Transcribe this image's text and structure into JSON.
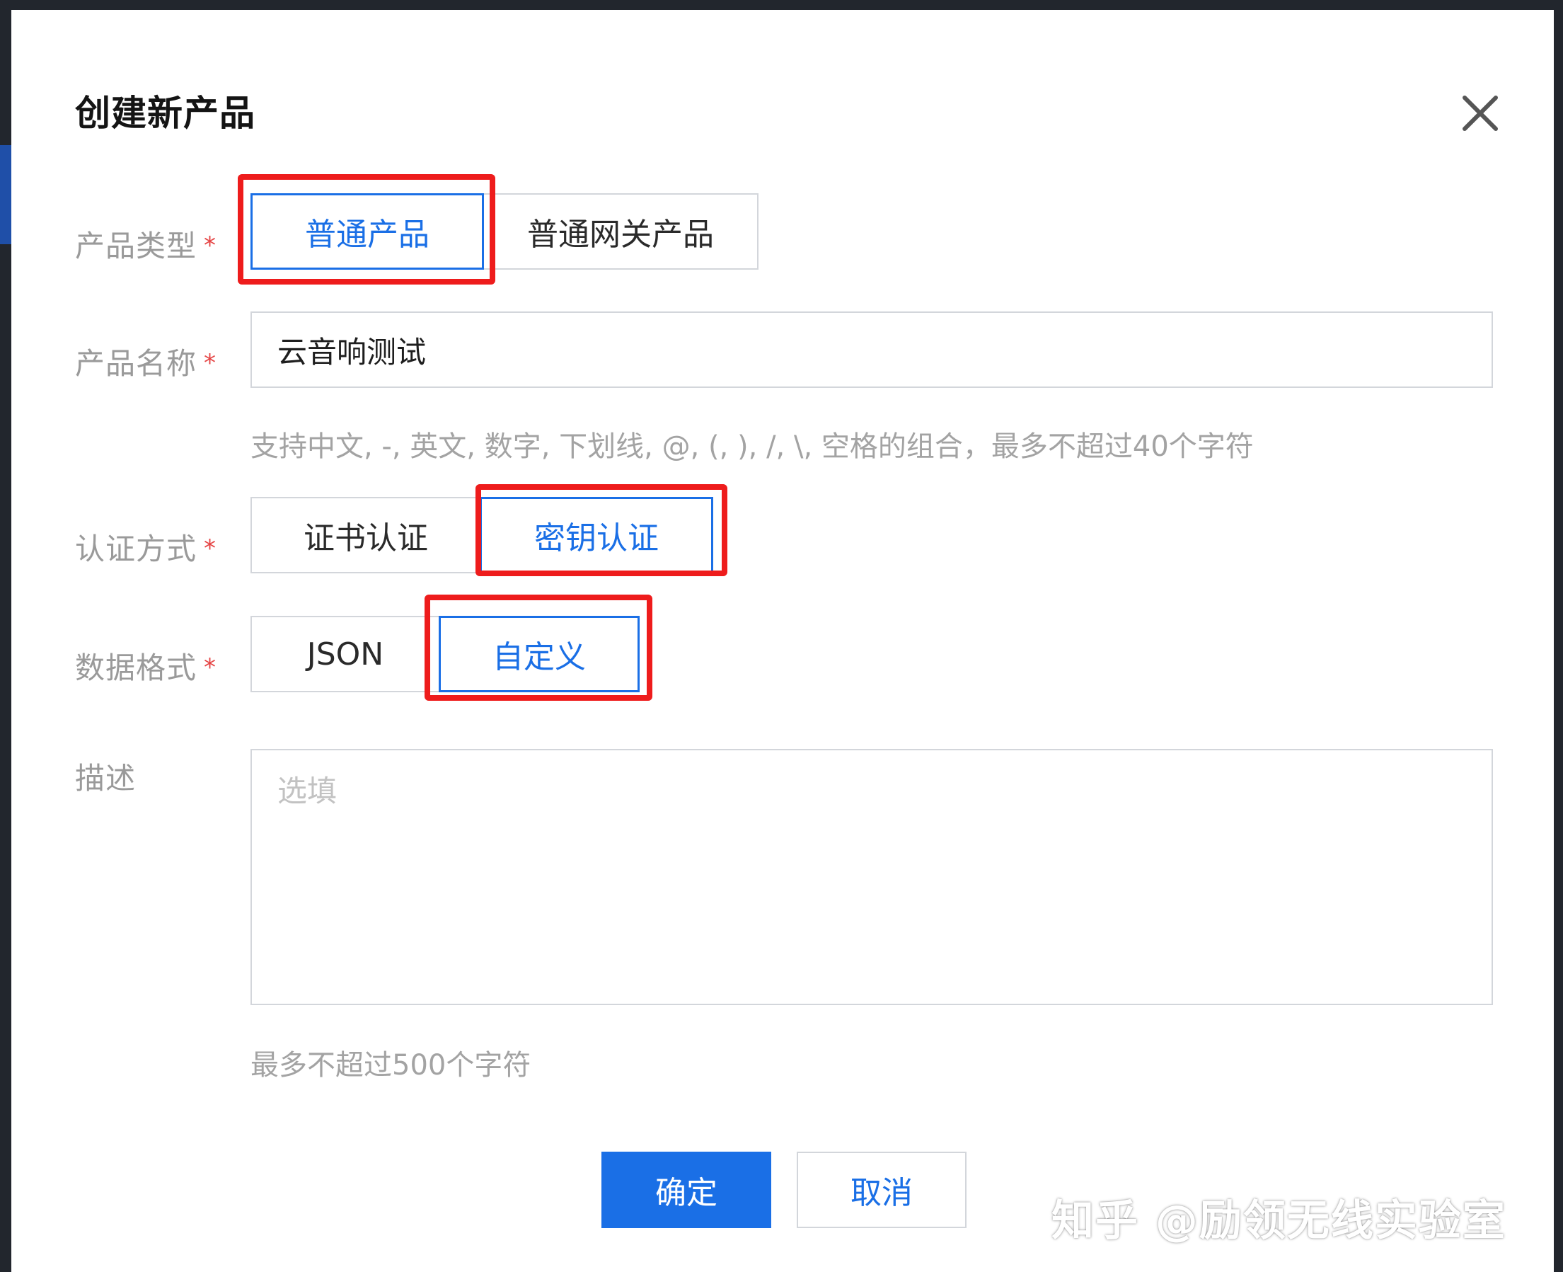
{
  "dialog": {
    "title": "创建新产品"
  },
  "fields": {
    "product_type": {
      "label": "产品类型",
      "required_mark": "*",
      "options": [
        "普通产品",
        "普通网关产品"
      ],
      "selected": "普通产品"
    },
    "product_name": {
      "label": "产品名称",
      "required_mark": "*",
      "value": "云音响测试",
      "hint": "支持中文, -, 英文, 数字, 下划线, @, (, ), /, \\, 空格的组合，最多不超过40个字符"
    },
    "auth_method": {
      "label": "认证方式",
      "required_mark": "*",
      "options": [
        "证书认证",
        "密钥认证"
      ],
      "selected": "密钥认证"
    },
    "data_format": {
      "label": "数据格式",
      "required_mark": "*",
      "options": [
        "JSON",
        "自定义"
      ],
      "selected": "自定义"
    },
    "description": {
      "label": "描述",
      "placeholder": "选填",
      "hint": "最多不超过500个字符"
    }
  },
  "buttons": {
    "confirm": "确定",
    "cancel": "取消"
  },
  "watermark": "知乎 @励领无线实验室",
  "colors": {
    "accent": "#1a6fe6",
    "highlight_frame": "#ee1c1c",
    "required": "#e54545"
  }
}
